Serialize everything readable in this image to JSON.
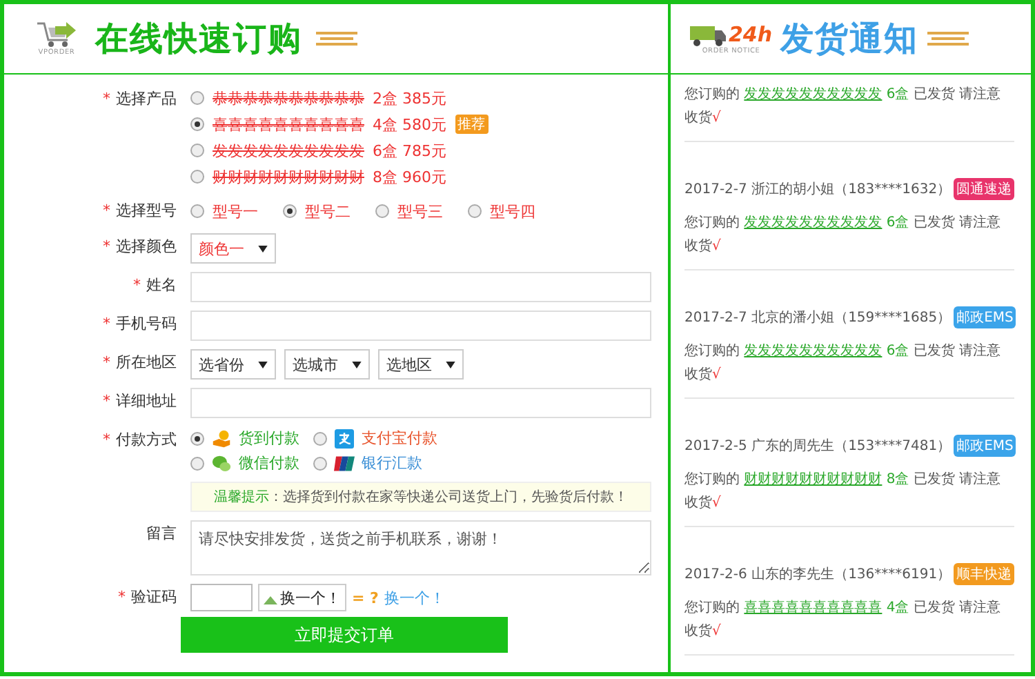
{
  "order_panel": {
    "logo_caption": "VPORDER",
    "title": "在线快速订购",
    "required_mark": "*",
    "fields": [
      {
        "kind": "products",
        "label": "选择产品",
        "required": true,
        "options": [
          {
            "name": "恭恭恭恭恭恭恭恭恭恭",
            "detail": "2盒 385元",
            "selected": false
          },
          {
            "name": "喜喜喜喜喜喜喜喜喜喜",
            "detail": "4盒 580元",
            "badge": "推荐",
            "selected": true
          },
          {
            "name": "发发发发发发发发发发",
            "detail": "6盒 785元",
            "selected": false
          },
          {
            "name": "财财财财财财财财财财",
            "detail": "8盒 960元",
            "selected": false
          }
        ]
      },
      {
        "kind": "radios",
        "label": "选择型号",
        "required": true,
        "options": [
          {
            "label": "型号一",
            "selected": false
          },
          {
            "label": "型号二",
            "selected": true
          },
          {
            "label": "型号三",
            "selected": false
          },
          {
            "label": "型号四",
            "selected": false
          }
        ]
      },
      {
        "kind": "select",
        "label": "选择颜色",
        "required": true,
        "value": "颜色一"
      },
      {
        "kind": "input",
        "label": "姓名",
        "required": true
      },
      {
        "kind": "input",
        "label": "手机号码",
        "required": true
      },
      {
        "kind": "region",
        "label": "所在地区",
        "required": true,
        "selects": [
          "选省份",
          "选城市",
          "选地区"
        ]
      },
      {
        "kind": "input",
        "label": "详细地址",
        "required": true
      },
      {
        "kind": "payment",
        "label": "付款方式",
        "required": true,
        "options": [
          {
            "label": "货到付款",
            "color": "#2aa82a",
            "selected": true
          },
          {
            "label": "支付宝付款",
            "color": "#e8532b",
            "selected": false
          },
          {
            "label": "微信付款",
            "color": "#2aa82a",
            "selected": false
          },
          {
            "label": "银行汇款",
            "color": "#3b8fd6",
            "selected": false
          }
        ],
        "tip_title": "温馨提示",
        "tip": "：选择货到付款在家等快递公司送货上门，先验货后付款！"
      },
      {
        "kind": "textarea",
        "label": "留言",
        "required": false,
        "value": "请尽快安排发货，送货之前手机联系，谢谢！"
      },
      {
        "kind": "captcha",
        "label": "验证码",
        "required": true,
        "image_alt": "换一个！",
        "question": "= ?",
        "refresh": "换一个！"
      }
    ],
    "submit": "立即提交订单"
  },
  "notice_panel": {
    "logo_badge": "24h",
    "logo_caption": "ORDER NOTICE",
    "title": "发货通知",
    "entries": [
      {
        "message": {
          "prefix": "您订购的",
          "product": "发发发发发发发发发发",
          "qty": "6盒",
          "suffix": "已发货 请注意收货",
          "mark": "√"
        }
      },
      {
        "header": "2017-2-7 浙江的胡小姐（183****1632）",
        "badge": "圆通速递",
        "color": "#e8336b",
        "message": {
          "prefix": "您订购的",
          "product": "发发发发发发发发发发",
          "qty": "6盒",
          "suffix": "已发货 请注意收货",
          "mark": "√"
        }
      },
      {
        "header": "2017-2-7 北京的潘小姐（159****1685）",
        "badge": "邮政EMS",
        "color": "#3ba4ea",
        "message": {
          "prefix": "您订购的",
          "product": "发发发发发发发发发发",
          "qty": "6盒",
          "suffix": "已发货 请注意收货",
          "mark": "√"
        }
      },
      {
        "header": "2017-2-5 广东的周先生（153****7481）",
        "badge": "邮政EMS",
        "color": "#3ba4ea",
        "message": {
          "prefix": "您订购的",
          "product": "财财财财财财财财财财",
          "qty": "8盒",
          "suffix": "已发货 请注意收货",
          "mark": "√"
        }
      },
      {
        "header": "2017-2-6 山东的李先生（136****6191）",
        "badge": "顺丰快递",
        "color": "#f29a1f",
        "message": {
          "prefix": "您订购的",
          "product": "喜喜喜喜喜喜喜喜喜喜",
          "qty": "4盒",
          "suffix": "已发货 请注意收货",
          "mark": "√"
        }
      }
    ]
  }
}
